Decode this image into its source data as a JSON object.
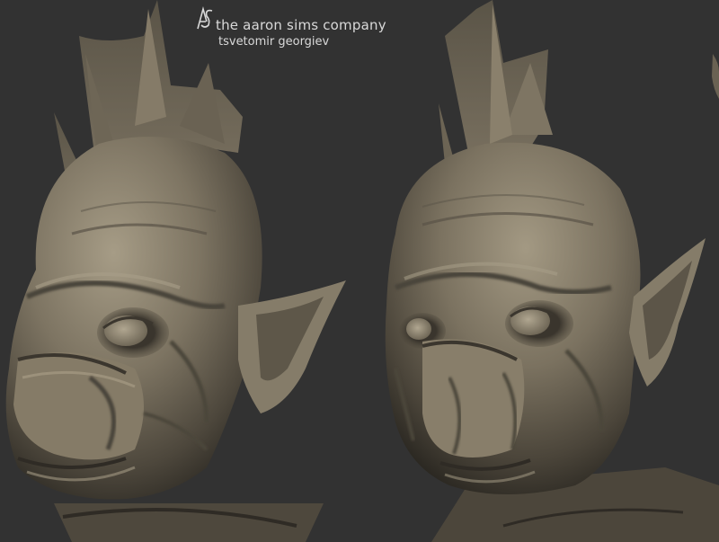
{
  "watermark": {
    "logo_text": "AS",
    "company": "the aaron sims company",
    "artist": "tsvetomir georgiev"
  },
  "views": [
    {
      "subject": "creature-head-sculpt",
      "angle": "three-quarter-left"
    },
    {
      "subject": "creature-head-sculpt",
      "angle": "front-slightly-right"
    }
  ],
  "colors": {
    "background": "#323232",
    "clay_light": "#9c927d",
    "clay_mid": "#6f6757",
    "clay_dark": "#2e2a24",
    "watermark_text": "#d9d9d9"
  }
}
